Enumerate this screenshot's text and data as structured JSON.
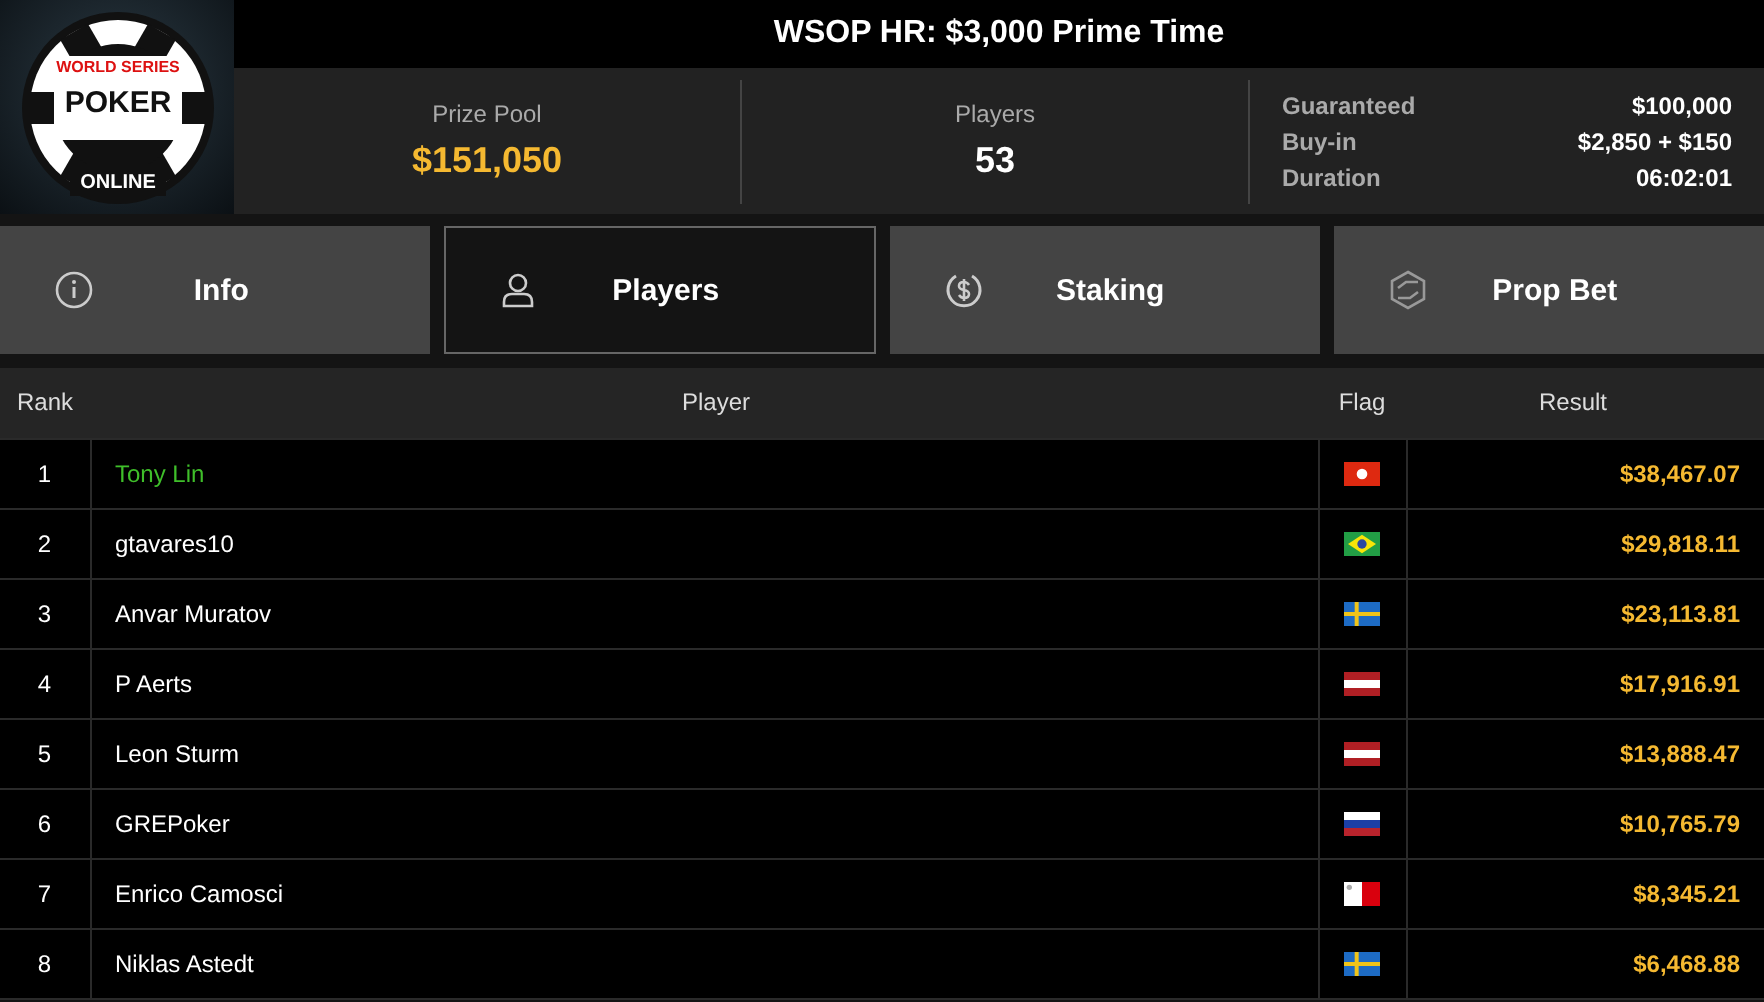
{
  "logo": {
    "top": "WORLD SERIES",
    "main": "POKER",
    "bottom": "ONLINE"
  },
  "title": "WSOP HR: $3,000 Prime Time",
  "stats": [
    {
      "label": "Prize Pool",
      "value": "$151,050",
      "kind": "money"
    },
    {
      "label": "Players",
      "value": "53",
      "kind": "count"
    }
  ],
  "details": [
    {
      "label": "Guaranteed",
      "value": "$100,000"
    },
    {
      "label": "Buy-in",
      "value": "$2,850 + $150"
    },
    {
      "label": "Duration",
      "value": "06:02:01"
    }
  ],
  "tabs": [
    {
      "label": "Info",
      "kind": "info",
      "selected": false
    },
    {
      "label": "Players",
      "kind": "person",
      "selected": true
    },
    {
      "label": "Staking",
      "kind": "dollar",
      "selected": false
    },
    {
      "label": "Prop Bet",
      "kind": "hex",
      "selected": false
    }
  ],
  "table": {
    "columns": [
      "Rank",
      "Player",
      "Flag",
      "Result"
    ],
    "rows": [
      {
        "rank": "1",
        "player": "Tony Lin",
        "kind": "hk",
        "result": "$38,467.07",
        "highlighted": true
      },
      {
        "rank": "2",
        "player": "gtavares10",
        "kind": "br",
        "result": "$29,818.11",
        "highlighted": false
      },
      {
        "rank": "3",
        "player": "Anvar Muratov",
        "kind": "se",
        "result": "$23,113.81",
        "highlighted": false
      },
      {
        "rank": "4",
        "player": "P Aerts",
        "kind": "at",
        "result": "$17,916.91",
        "highlighted": false
      },
      {
        "rank": "5",
        "player": "Leon Sturm",
        "kind": "at",
        "result": "$13,888.47",
        "highlighted": false
      },
      {
        "rank": "6",
        "player": "GREPoker",
        "kind": "ru",
        "result": "$10,765.79",
        "highlighted": false
      },
      {
        "rank": "7",
        "player": "Enrico Camosci",
        "kind": "mt",
        "result": "$8,345.21",
        "highlighted": false
      },
      {
        "rank": "8",
        "player": "Niklas Astedt",
        "kind": "se",
        "result": "$6,468.88",
        "highlighted": false
      }
    ]
  }
}
